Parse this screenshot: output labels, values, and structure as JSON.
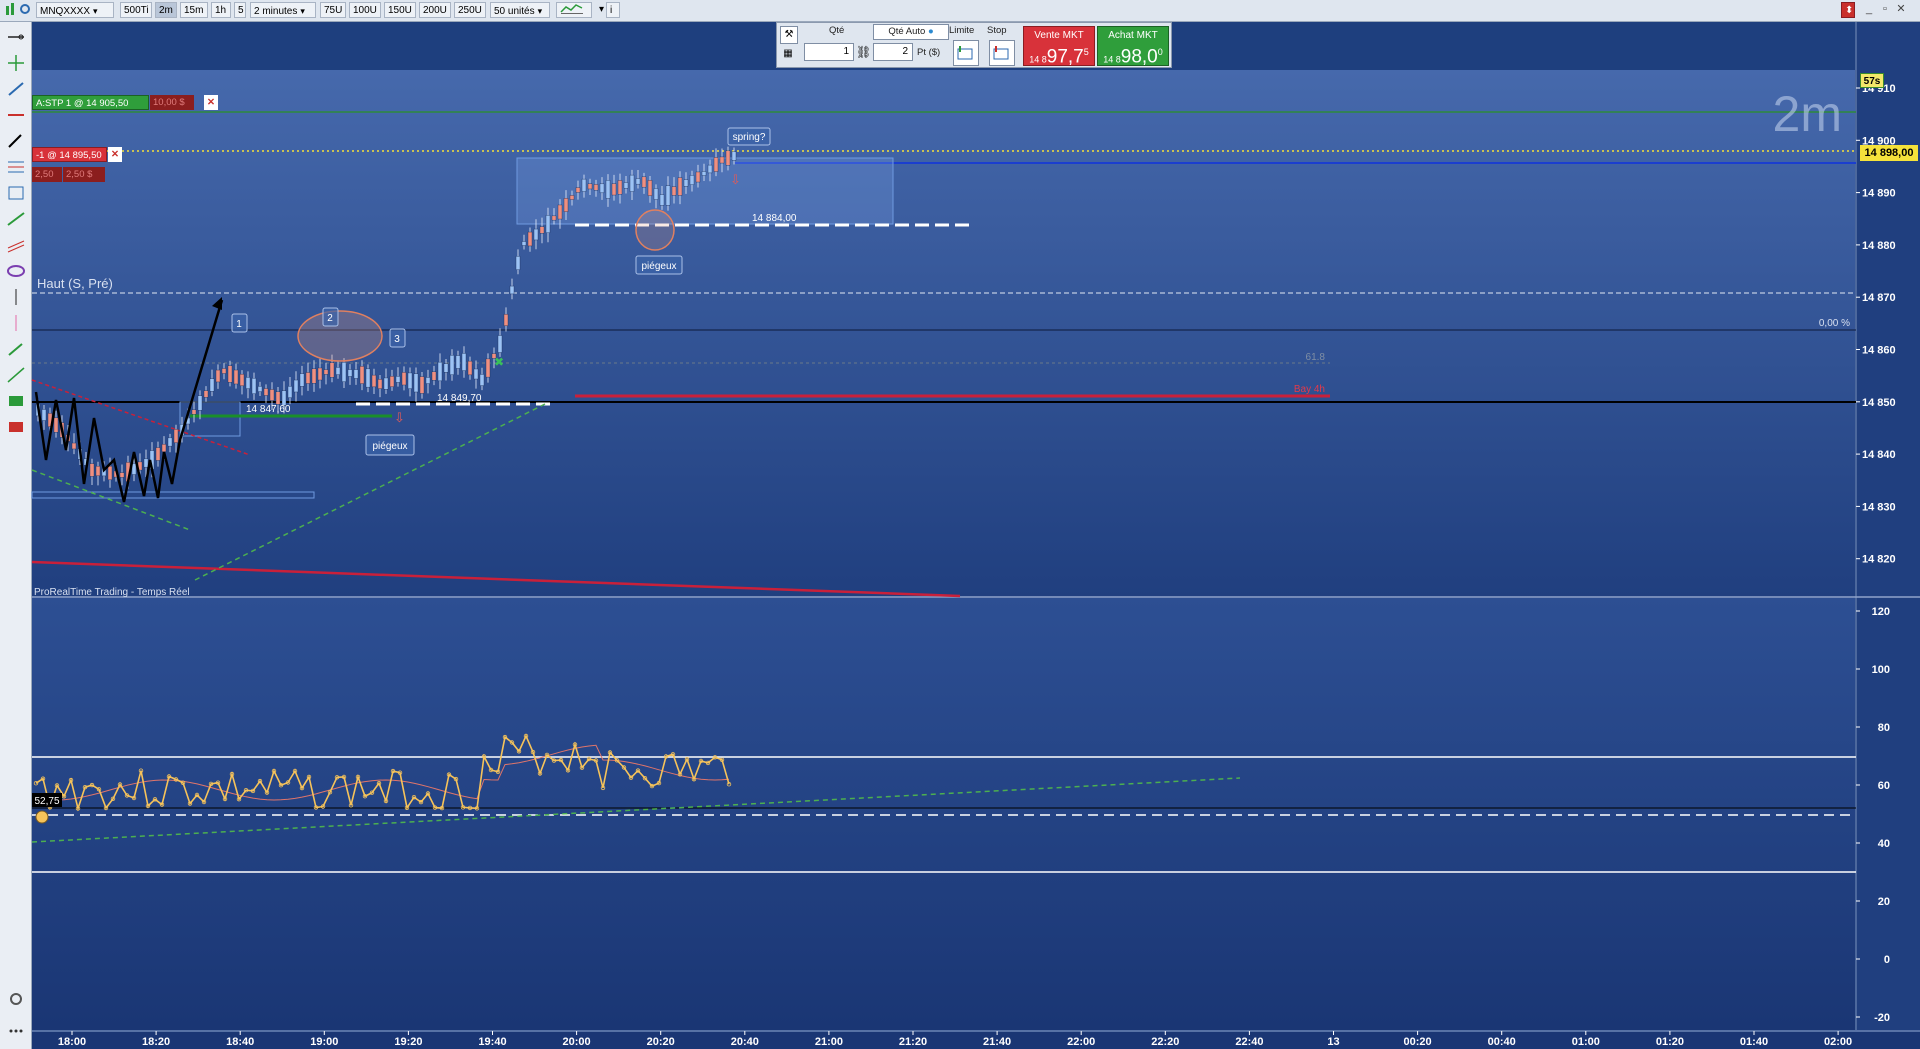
{
  "toolbar": {
    "instrument": "MNQXXXX",
    "buttons": [
      "500Ti",
      "2m",
      "15m",
      "1h",
      "5"
    ],
    "interval": "2 minutes",
    "units": [
      "75U",
      "100U",
      "150U",
      "200U",
      "250U"
    ],
    "quantity_units": "50 unités"
  },
  "trade_panel": {
    "qty_label": "Qté",
    "qty_value": "1",
    "qty_auto_label": "Qté Auto",
    "pts_value": "2",
    "pts_unit": "Pt ($)",
    "limit_label": "Limite",
    "stop_label": "Stop",
    "sell_label": "Vente MKT",
    "sell_prefix": "14 8",
    "sell_price": "97,7",
    "sell_suffix": "5",
    "buy_label": "Achat MKT",
    "buy_prefix": "14 8",
    "buy_price": "98,0",
    "buy_suffix": "0"
  },
  "orders": {
    "stop_order": "A:STP  1 @ 14 905,50",
    "stop_pl": "10,00 $",
    "position": "-1 @ 14 895,50",
    "position_pl_a": "2,50",
    "position_pl_b": "2,50 $"
  },
  "chart": {
    "timeframe_watermark": "2m",
    "countdown": "57s",
    "current_price": "14 898,00",
    "source_label": "ProRealTime Trading - Temps Réel",
    "level_label_high": "Haut (S, Pré)",
    "fib_label": "0,00 %",
    "fib_level_text": "61.8",
    "red_line_label": "Bay 4h",
    "annotations": {
      "spring": "spring?",
      "trap_top": "piégeux",
      "trap_bottom": "piégeux",
      "level_14884": "14 884,00",
      "level_14847": "14 847,60",
      "level_14849": "14 849,70",
      "num1": "1",
      "num2": "2",
      "num3": "3"
    },
    "price_axis": [
      "14 910",
      "14 900",
      "14 890",
      "14 880",
      "14 870",
      "14 860",
      "14 850",
      "14 840",
      "14 830",
      "14 820"
    ],
    "osc_axis": [
      "120",
      "100",
      "80",
      "60",
      "40",
      "20",
      "0",
      "-20"
    ],
    "osc_value": "52,75",
    "time_axis": [
      "18:00",
      "18:20",
      "18:40",
      "19:00",
      "19:20",
      "19:40",
      "20:00",
      "20:20",
      "20:40",
      "21:00",
      "21:20",
      "21:40",
      "22:00",
      "22:20",
      "22:40",
      "13",
      "00:20",
      "00:40",
      "01:00",
      "01:20",
      "01:40",
      "02:00"
    ],
    "colors": {
      "background": "#1e3f7e",
      "bull": "#9cc3f5",
      "bear": "#f08f80",
      "price_tag": "#f5e23b",
      "oscillator": "#f6c35a"
    }
  }
}
